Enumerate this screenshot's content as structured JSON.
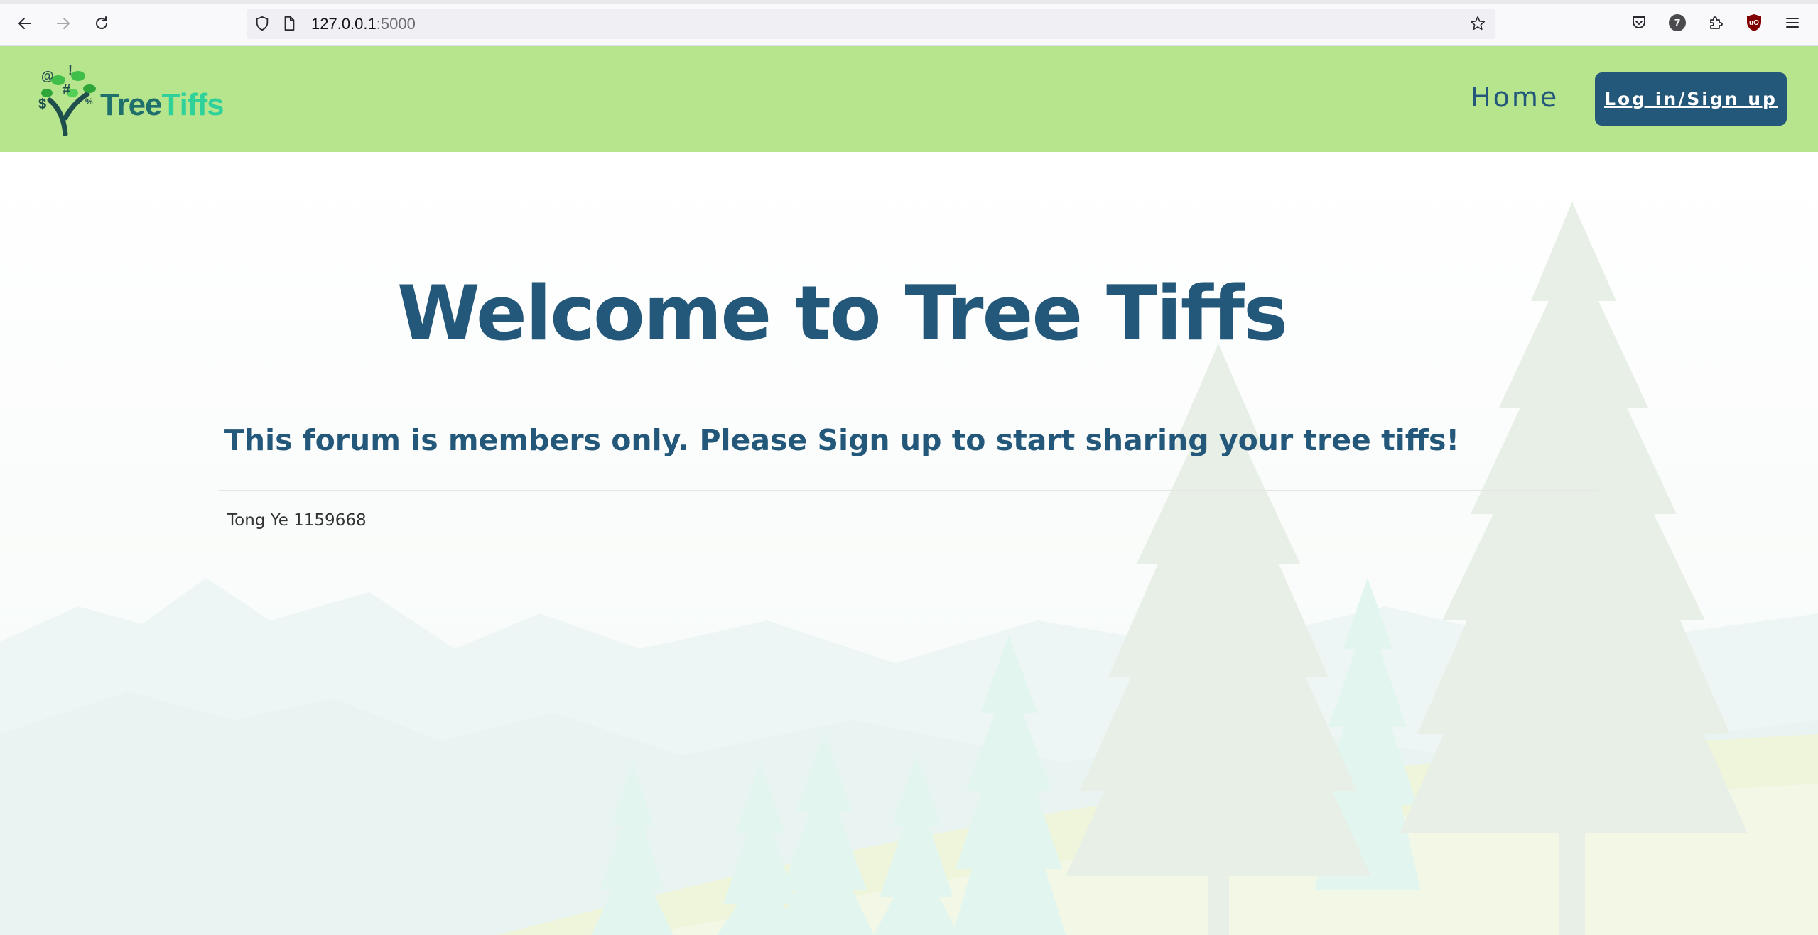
{
  "browser": {
    "url_host": "127.0.0.1",
    "url_port": ":5000",
    "extension_badge": "7",
    "ublock_label": "uO"
  },
  "header": {
    "logo": {
      "word1": "Tree",
      "word2": "Tiffs",
      "glyphs": [
        "@",
        "!",
        "#",
        "$",
        "%"
      ]
    },
    "nav_home": "Home",
    "login_label": "Log in/Sign up"
  },
  "main": {
    "title": "Welcome to Tree Tiffs",
    "subtitle": "This forum is members only. Please Sign up to start sharing your tree tiffs!",
    "footer_note": "Tong Ye 1159668"
  },
  "colors": {
    "header_bg": "#b7e58d",
    "brand_blue": "#24587a",
    "logo_green": "#2fd19b"
  }
}
